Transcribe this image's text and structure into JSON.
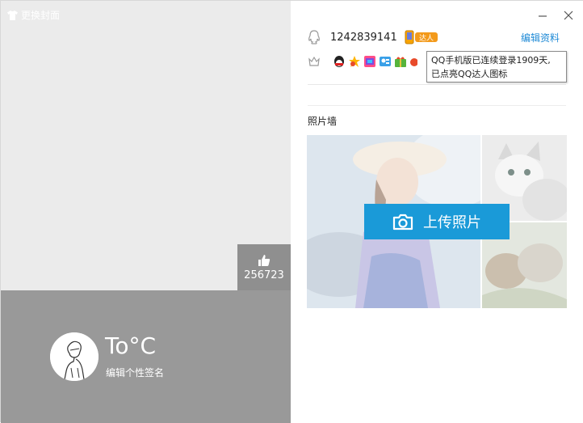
{
  "cover": {
    "label": "更换封面"
  },
  "likes": {
    "count": "256723"
  },
  "profile": {
    "nickname": "To°C",
    "signature_placeholder": "编辑个性签名"
  },
  "header": {
    "qq_number": "1242839141",
    "daren_label": "达人",
    "edit_profile_label": "编辑资料"
  },
  "tooltip": {
    "line1": "QQ手机版已连续登录1909天,",
    "line2": "已点亮QQ达人图标"
  },
  "photo_wall": {
    "title": "照片墙",
    "upload_label": "上传照片"
  },
  "icons": {
    "qq": "qq-penguin-icon",
    "vip": "vip-level-icon",
    "minimize": "minimize-icon",
    "close": "close-icon",
    "like": "thumbs-up-icon",
    "camera": "camera-icon",
    "cover": "shirt-icon"
  },
  "colors": {
    "accent": "#1a9ad8",
    "link": "#1f8ad6",
    "profile_strip": "#999999",
    "left_bg": "#ebebeb"
  }
}
